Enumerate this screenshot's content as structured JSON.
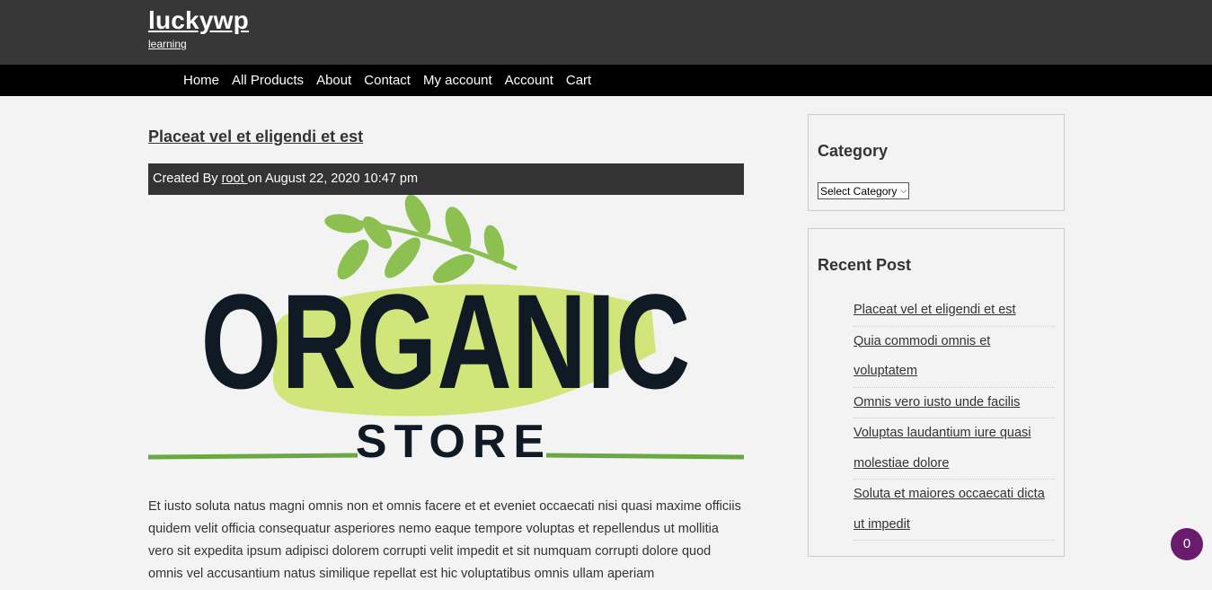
{
  "site": {
    "title": "luckywp",
    "tagline": "learning"
  },
  "nav": {
    "items": [
      "Home",
      "All Products",
      "About",
      "Contact",
      "My account",
      "Account",
      "Cart"
    ]
  },
  "post": {
    "title": "Placeat vel et eligendi et est",
    "meta_prefix": "Created By ",
    "author": "root ",
    "meta_suffix": "on August 22, 2020 10:47 pm",
    "logo": {
      "word1": "ORGANIC",
      "word2": "STORE",
      "colors": {
        "text": "#0f1a24",
        "brush": "#d2e57a",
        "leaf": "#8cc152",
        "line": "#6aa842"
      }
    },
    "body": "Et iusto soluta natus magni omnis non et omnis facere et et eveniet occaecati nisi quasi maxime officiis quidem velit officia consequatur asperiores nemo eaque tempore voluptas et repellendus ut mollitia vero sit expedita ipsum adipisci dolorem corrupti velit impedit et sit numquam corrupti dolore quod omnis vel accusantium natus similique repellat est hic voluptatibus omnis ullam aperiam"
  },
  "sidebar": {
    "category": {
      "title": "Category",
      "select_value": "Select Category"
    },
    "recent": {
      "title": "Recent Post",
      "items": [
        "Placeat vel et eligendi et est",
        "Quia commodi omnis et voluptatem",
        "Omnis vero iusto unde facilis",
        "Voluptas laudantium iure quasi molestiae dolore",
        "Soluta et maiores occaecati dicta ut impedit"
      ]
    }
  },
  "cart": {
    "count": "0",
    "badge_color": "#6b1b6e"
  }
}
